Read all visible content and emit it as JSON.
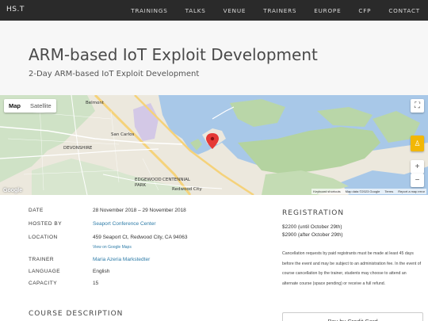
{
  "nav": {
    "brand": "HS.T",
    "items": [
      "TRAININGS",
      "TALKS",
      "VENUE",
      "TRAINERS",
      "EUROPE",
      "CFP",
      "CONTACT"
    ]
  },
  "hero": {
    "title": "ARM-based IoT Exploit Development",
    "subtitle": "2-Day ARM-based IoT Exploit Development"
  },
  "map": {
    "tabs": [
      "Map",
      "Satellite"
    ],
    "active_tab": "Map",
    "labels": {
      "belmont": "Belmont",
      "san_carlos": "San Carlos",
      "devonshire": "DEVONSHIRE",
      "edgewood_park": "EDGEWOOD\nPARK",
      "centennial": "CENTENNIAL",
      "redwood_city": "Redwood City"
    },
    "google": "Google",
    "footer": [
      "Keyboard shortcuts",
      "Map data ©2023 Google",
      "Terms",
      "Report a map error"
    ],
    "zoom_in": "+",
    "zoom_out": "−",
    "fullscreen_icon": "fullscreen-icon",
    "pegman_icon": "pegman-icon"
  },
  "details": {
    "date_label": "DATE",
    "date_value": "28 November 2018 – 29 November 2018",
    "hosted_label": "HOSTED BY",
    "hosted_value": "Seaport Conference Center",
    "location_label": "LOCATION",
    "location_value": "459 Seaport Ct, Redwood City, CA 94063",
    "view_maps": "View on Google Maps",
    "trainer_label": "TRAINER",
    "trainer_value": "Maria Azeria Markstedter",
    "language_label": "LANGUAGE",
    "language_value": "English",
    "capacity_label": "CAPACITY",
    "capacity_value": "15"
  },
  "course_title": "COURSE DESCRIPTION",
  "registration": {
    "title": "REGISTRATION",
    "price_early": "$2200 (until October 29th)",
    "price_late": "$2900 (after October 29th)",
    "policy": "Cancellation requests by paid registrants must be made at least 45 days before the event and may be subject to an administration fee. In the event of course cancellation by the trainer, students may choose to attend an alternate course (space pending) or receive a full refund.",
    "card_button": "Pay by Credit Card"
  }
}
